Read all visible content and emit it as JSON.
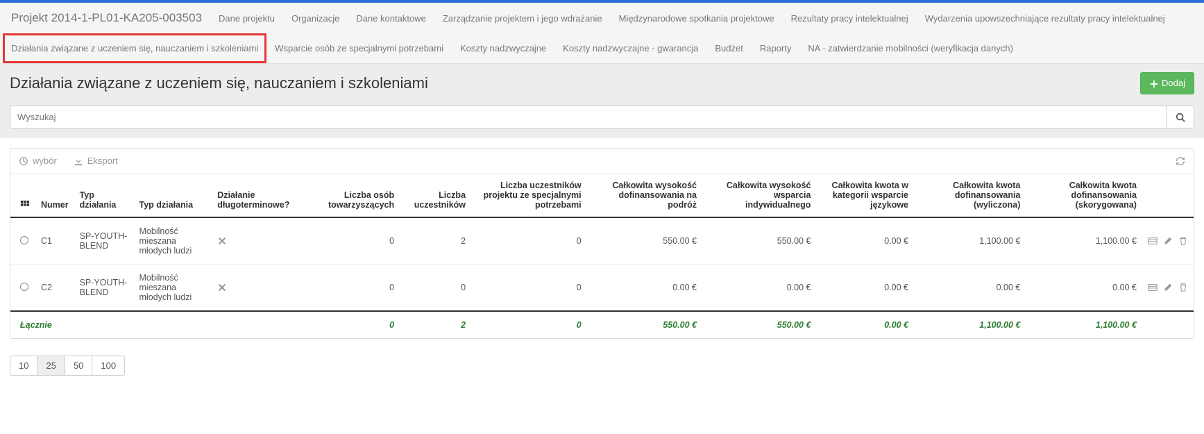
{
  "project_title": "Projekt 2014-1-PL01-KA205-003503",
  "nav": {
    "row1": [
      "Dane projektu",
      "Organizacje",
      "Dane kontaktowe",
      "Zarządzanie projektem i jego wdrażanie",
      "Międzynarodowe spotkania projektowe",
      "Rezultaty pracy intelektualnej",
      "Wydarzenia upowszechniające rezultaty pracy intelektualnej"
    ],
    "row2": [
      "Działania związane z uczeniem się, nauczaniem i szkoleniami",
      "Wsparcie osób ze specjalnymi potrzebami",
      "Koszty nadzwyczajne",
      "Koszty nadzwyczajne - gwarancja",
      "Budżet",
      "Raporty",
      "NA - zatwierdzanie mobilności (weryfikacja danych)"
    ],
    "active": "Działania związane z uczeniem się, nauczaniem i szkoleniami"
  },
  "page_heading": "Działania związane z uczeniem się, nauczaniem i szkoleniami",
  "add_label": "Dodaj",
  "search_placeholder": "Wyszukaj",
  "toolbar": {
    "select": "wybór",
    "export": "Eksport"
  },
  "columns": [
    "",
    "Numer",
    "Typ działania",
    "Typ działania",
    "Działanie długoterminowe?",
    "Liczba osób towarzyszących",
    "Liczba uczestników",
    "Liczba uczestników projektu ze specjalnymi potrzebami",
    "Całkowita wysokość dofinansowania na podróż",
    "Całkowita wysokość wsparcia indywidualnego",
    "Całkowita kwota w kategorii wsparcie językowe",
    "Całkowita kwota dofinansowania (wyliczona)",
    "Całkowita kwota dofinansowania (skorygowana)",
    ""
  ],
  "rows": [
    {
      "numer": "C1",
      "typ1": "SP-YOUTH-BLEND",
      "typ2": "Mobilność mieszana młodych ludzi",
      "long": false,
      "accomp": "0",
      "part": "2",
      "special": "0",
      "travel": "550.00 €",
      "indiv": "550.00 €",
      "lang": "0.00 €",
      "calc": "1,100.00 €",
      "adj": "1,100.00 €"
    },
    {
      "numer": "C2",
      "typ1": "SP-YOUTH-BLEND",
      "typ2": "Mobilność mieszana młodych ludzi",
      "long": false,
      "accomp": "0",
      "part": "0",
      "special": "0",
      "travel": "0.00 €",
      "indiv": "0.00 €",
      "lang": "0.00 €",
      "calc": "0.00 €",
      "adj": "0.00 €"
    }
  ],
  "total": {
    "label": "Łącznie",
    "accomp": "0",
    "part": "2",
    "special": "0",
    "travel": "550.00 €",
    "indiv": "550.00 €",
    "lang": "0.00 €",
    "calc": "1,100.00 €",
    "adj": "1,100.00 €"
  },
  "pager": [
    "10",
    "25",
    "50",
    "100"
  ],
  "pager_active": "25"
}
